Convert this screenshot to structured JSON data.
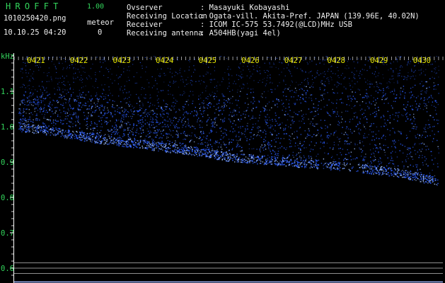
{
  "app": {
    "title": "HROFFT",
    "version": "1.00"
  },
  "capture": {
    "filename": "1010250420.png",
    "datetime": "10.10.25 04:20",
    "meteor_label": "meteor",
    "meteor_count": "0"
  },
  "info": [
    {
      "label": "Ovserver",
      "value": ": Masayuki Kobayashi"
    },
    {
      "label": "Receiving Location",
      "value": ": Ogata-vill. Akita-Pref. JAPAN (139.96E, 40.02N)"
    },
    {
      "label": "Receiver",
      "value": ": ICOM IC-575 53.7492(@LCD)MHz USB"
    },
    {
      "label": "Receiving antenna",
      "value": ": A504HB(yagi 4el)"
    }
  ],
  "colors": {
    "signal": "#2a5cff",
    "signal_bright": "#a0c0ff",
    "green_text": "#33d65c",
    "time_label": "#e8e800",
    "axis": "#ffffff"
  },
  "chart_data": {
    "type": "heatmap",
    "xlabel": "",
    "ylabel": "kHz",
    "x_tick_labels": [
      "0421",
      "0422",
      "0423",
      "0424",
      "0425",
      "0426",
      "0427",
      "0428",
      "0429",
      "0430"
    ],
    "y_tick_labels": [
      "1.1",
      "1.0",
      "0.9",
      "0.8",
      "0.7",
      "0.6"
    ],
    "y_ticks": [
      1.1,
      1.0,
      0.9,
      0.8,
      0.7,
      0.6
    ],
    "ylim": [
      0.58,
      1.2
    ],
    "xlim": [
      20.5,
      30.5
    ],
    "baseline_levels_khz": [
      0.615,
      0.6,
      0.585
    ],
    "series": [
      {
        "x": [
          20.6,
          21.5,
          22.5,
          23.5,
          24.5,
          25.5,
          26.5,
          27.5,
          28.5,
          29.5,
          30.4
        ],
        "values": [
          1.0,
          0.985,
          0.965,
          0.95,
          0.935,
          0.915,
          0.905,
          0.895,
          0.885,
          0.87,
          0.845
        ]
      },
      {
        "x": [
          20.6,
          22.0,
          23.5,
          25.0,
          26.5,
          27.5,
          28.5,
          29.5,
          30.4
        ],
        "values": [
          1.09,
          1.1,
          1.06,
          1.08,
          1.1,
          1.12,
          1.1,
          1.13,
          1.14
        ]
      }
    ]
  }
}
